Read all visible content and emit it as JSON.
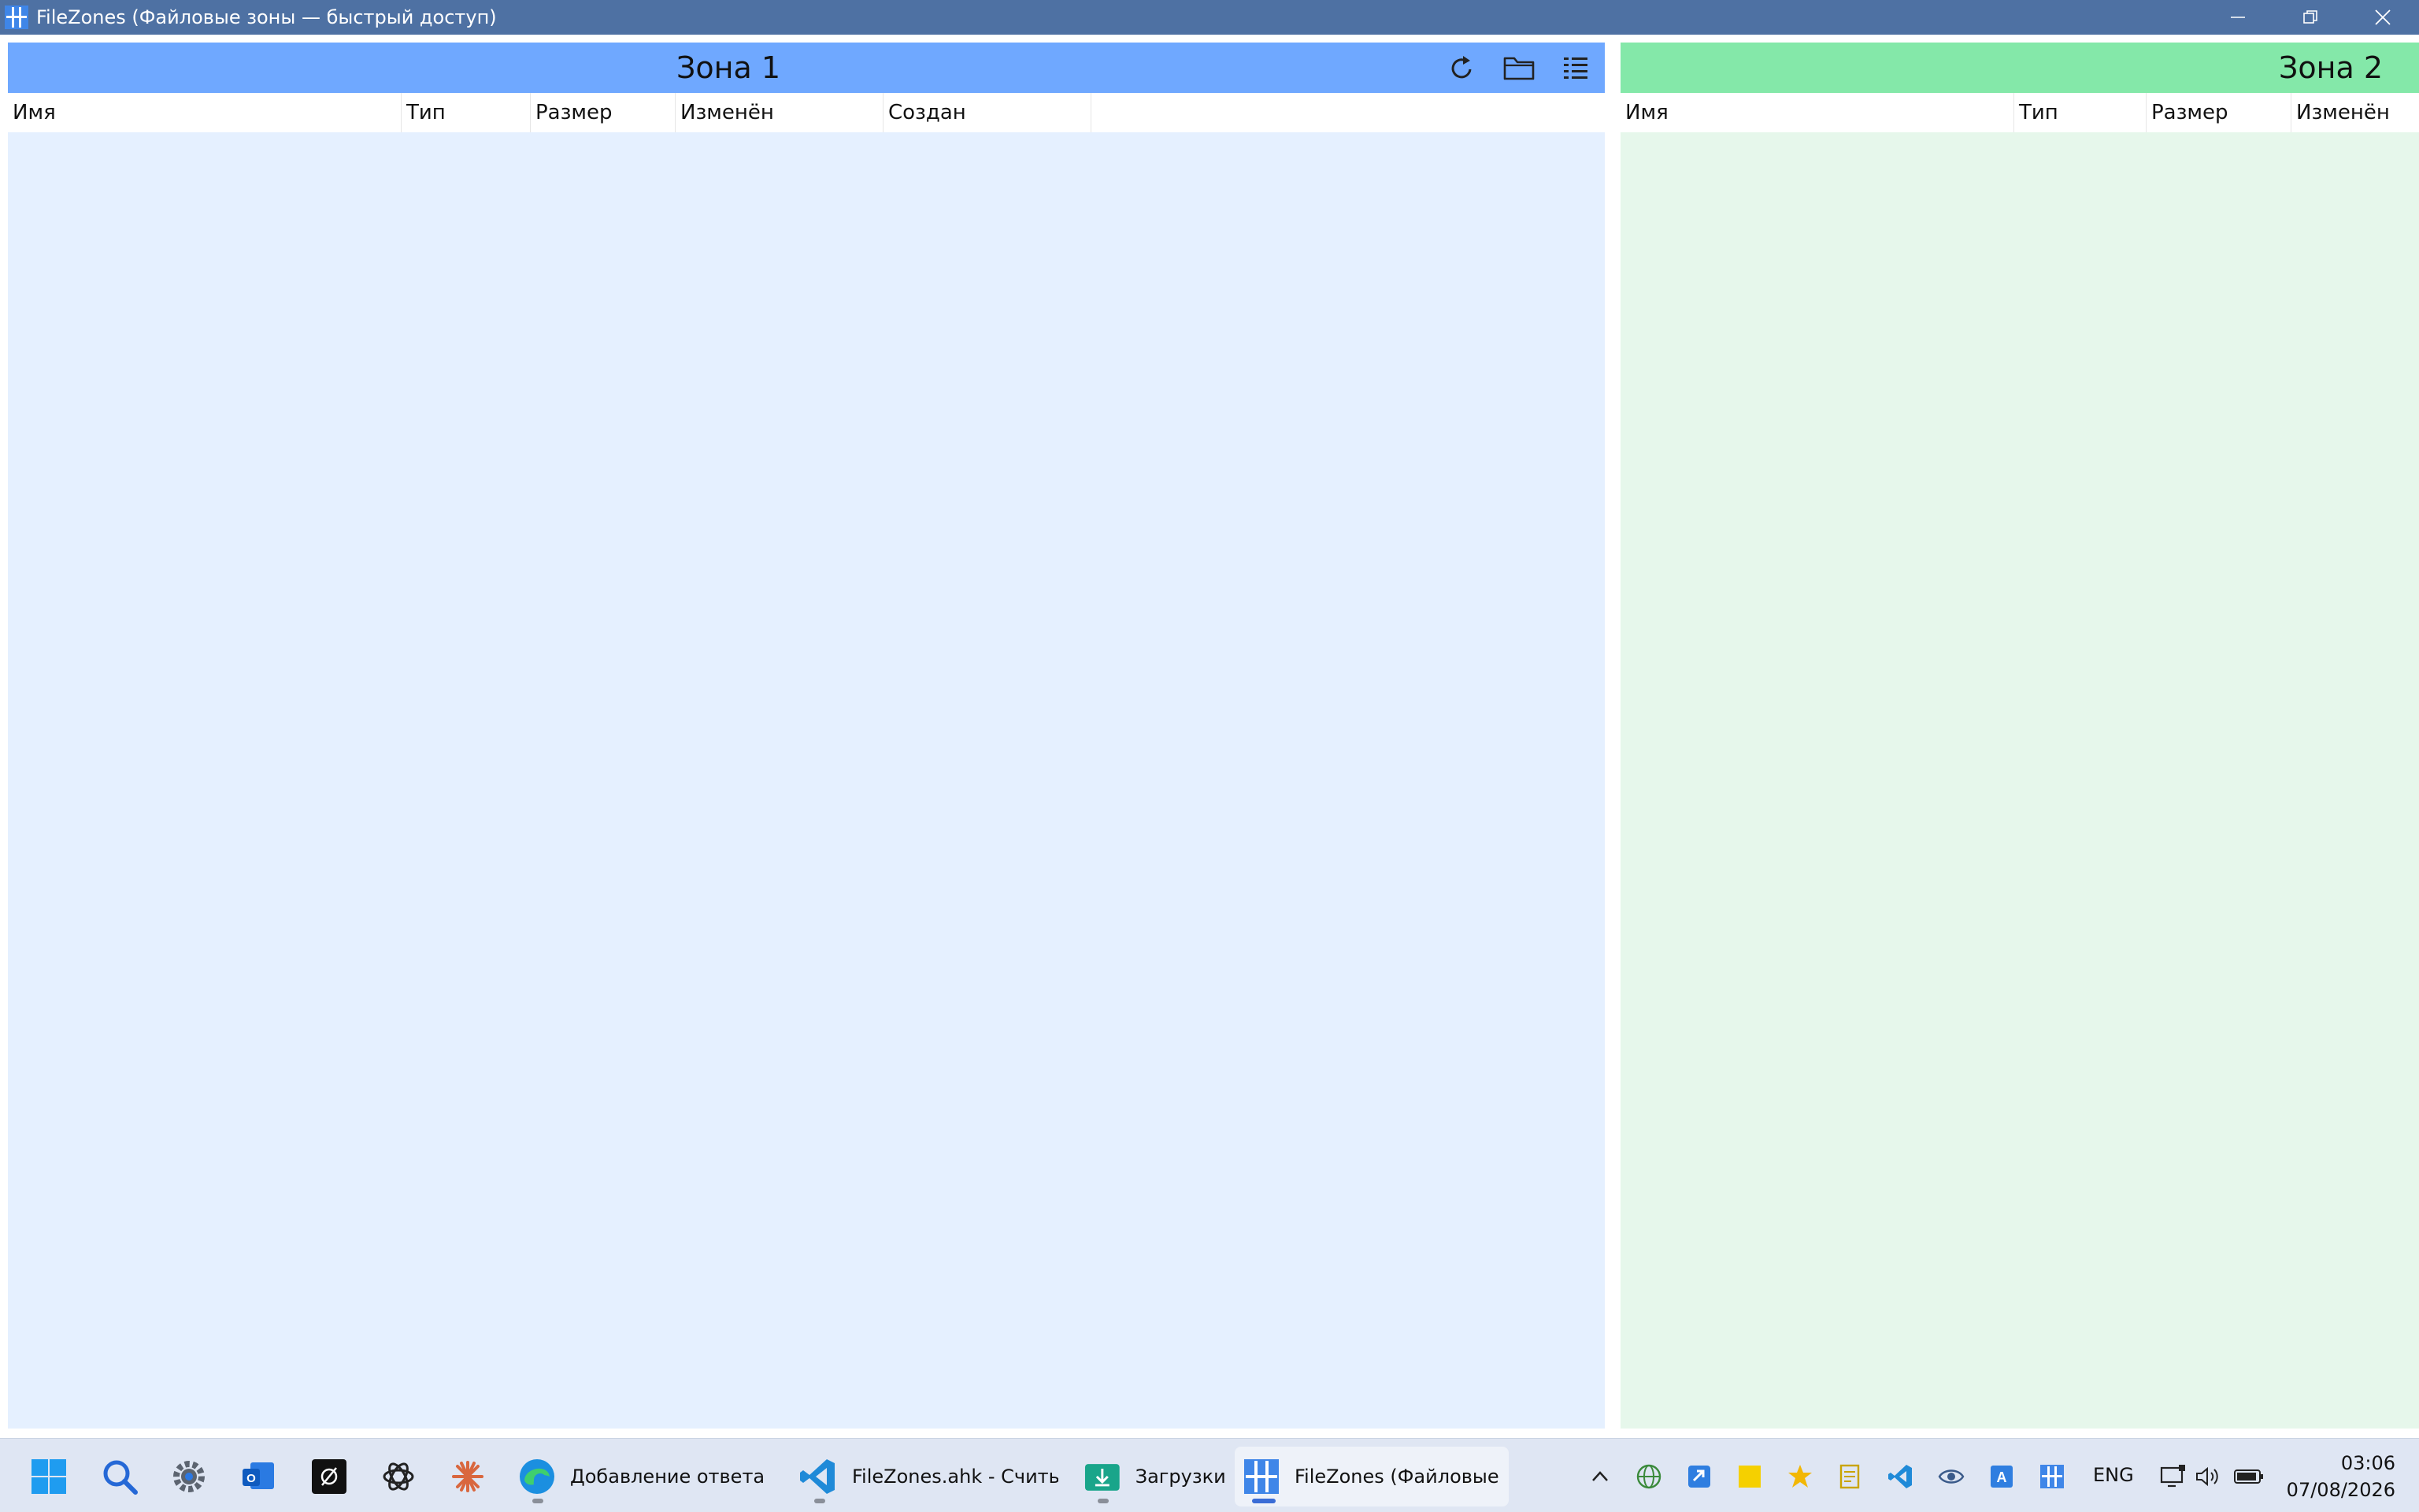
{
  "window": {
    "title": "FileZones (Файловые зоны — быстрый доступ)"
  },
  "panels": [
    {
      "title": "Зона 1",
      "header_color": "#6fa8ff",
      "body_color": "#e5f0ff",
      "columns": [
        "Имя",
        "Тип",
        "Размер",
        "Изменён",
        "Создан"
      ]
    },
    {
      "title": "Зона 2",
      "header_color": "#84e8a9",
      "body_color": "#e6f7eb",
      "columns": [
        "Имя",
        "Тип",
        "Размер",
        "Изменён"
      ]
    }
  ],
  "panel1_tools": [
    "refresh-icon",
    "folder-icon",
    "view-list-icon"
  ],
  "taskbar": {
    "pinned": [
      "start-icon",
      "search-icon",
      "settings-icon",
      "outlook-icon",
      "app-black-icon",
      "chatgpt-icon",
      "claude-icon"
    ],
    "tasks": [
      {
        "icon": "edge-icon",
        "label": "Добавление ответа —"
      },
      {
        "icon": "vscode-icon",
        "label": "FileZones.ahk - Считыв"
      },
      {
        "icon": "downloads-folder-icon",
        "label": "Загрузки"
      },
      {
        "icon": "filezones-icon",
        "label": "FileZones (Файловые зо"
      }
    ],
    "tray": {
      "language": "ENG",
      "time": "03:06",
      "date": "07/08/2026"
    }
  }
}
